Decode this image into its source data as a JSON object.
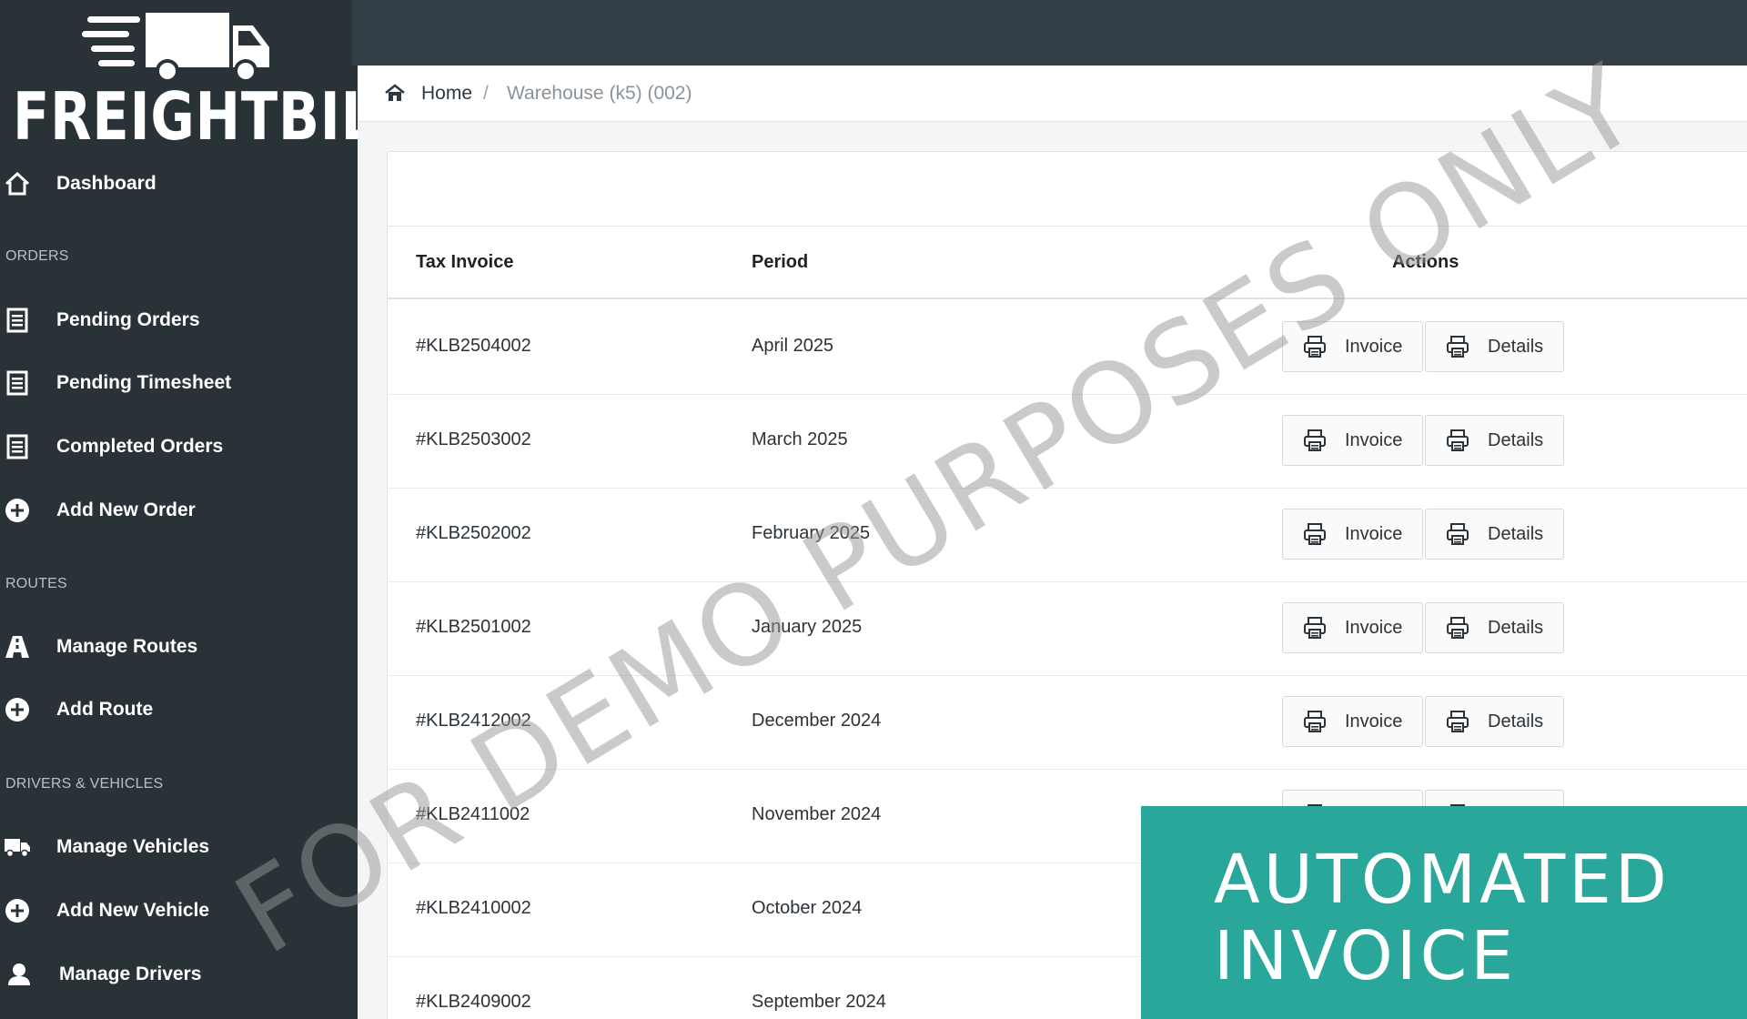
{
  "brand": {
    "name": "FREIGHTBILL"
  },
  "sidebar": {
    "dashboard": "Dashboard",
    "sections": {
      "orders": "ORDERS",
      "routes": "ROUTES",
      "drivers_vehicles": "DRIVERS & VEHICLES"
    },
    "items": {
      "pending_orders": "Pending Orders",
      "pending_timesheet": "Pending Timesheet",
      "completed_orders": "Completed Orders",
      "add_new_order": "Add New Order",
      "manage_routes": "Manage Routes",
      "add_route": "Add Route",
      "manage_vehicles": "Manage Vehicles",
      "add_new_vehicle": "Add New Vehicle",
      "manage_drivers": "Manage Drivers"
    }
  },
  "breadcrumb": {
    "home": "Home",
    "separator": "/",
    "current": "Warehouse (k5) (002)"
  },
  "table": {
    "headers": {
      "invoice": "Tax Invoice",
      "period": "Period",
      "actions": "Actions"
    },
    "invoice_btn": "Invoice",
    "details_btn": "Details",
    "rows": [
      {
        "invoice": "#KLB2504002",
        "period": "April 2025"
      },
      {
        "invoice": "#KLB2503002",
        "period": "March 2025"
      },
      {
        "invoice": "#KLB2502002",
        "period": "February 2025"
      },
      {
        "invoice": "#KLB2501002",
        "period": "January 2025"
      },
      {
        "invoice": "#KLB2412002",
        "period": "December 2024"
      },
      {
        "invoice": "#KLB2411002",
        "period": "November 2024"
      },
      {
        "invoice": "#KLB2410002",
        "period": "October 2024"
      },
      {
        "invoice": "#KLB2409002",
        "period": "September 2024"
      }
    ]
  },
  "watermark": "FOR DEMO PURPOSES ONLY",
  "banner": {
    "line1": "AUTOMATED",
    "line2": "INVOICE"
  },
  "colors": {
    "sidebar_bg": "#283237",
    "topbar_bg": "#323f47",
    "banner_bg": "#2aa79b"
  }
}
